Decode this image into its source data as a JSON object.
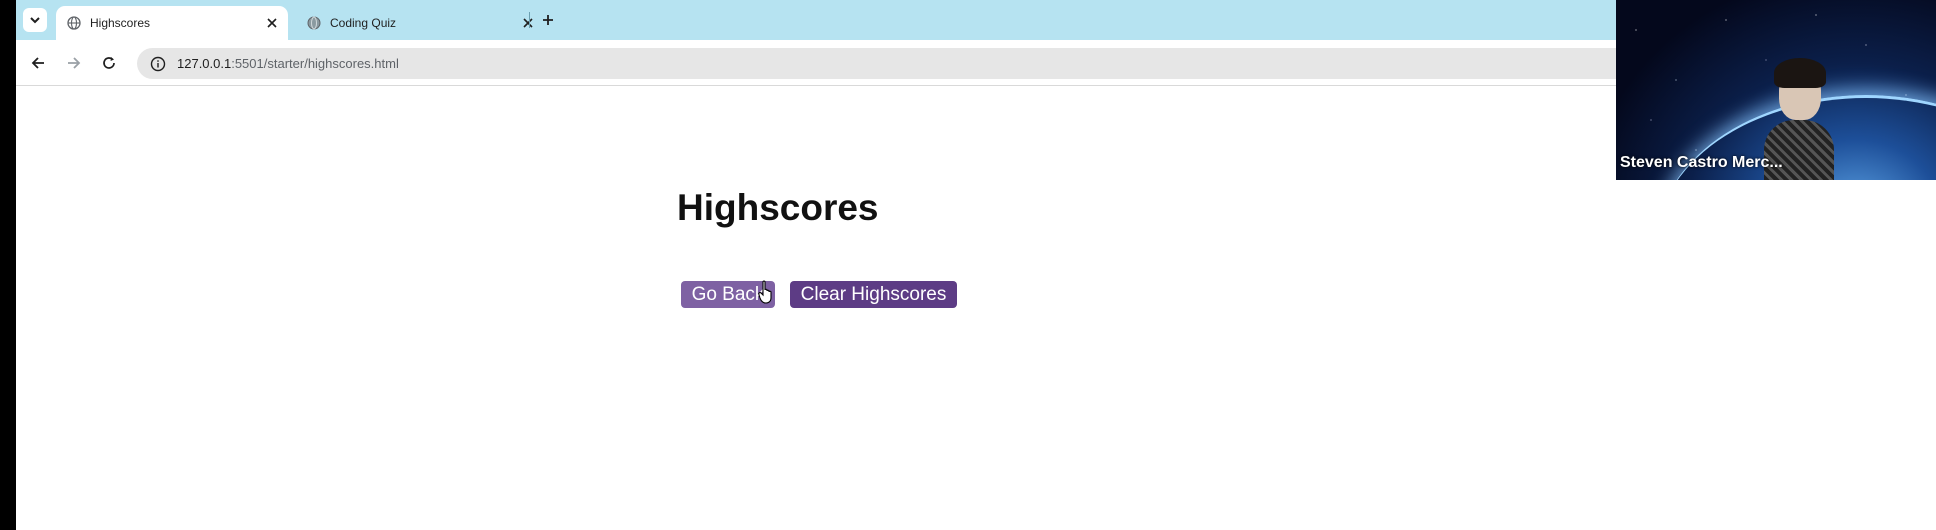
{
  "browser": {
    "tabs": [
      {
        "title": "Highscores",
        "active": true,
        "icon": "globe-icon"
      },
      {
        "title": "Coding Quiz",
        "active": false,
        "icon": "globe-icon"
      }
    ],
    "address_bar": {
      "host": "127.0.0.1",
      "path": ":5501/starter/highscores.html"
    }
  },
  "page": {
    "title": "Highscores",
    "buttons": {
      "go_back": "Go Back",
      "clear": "Clear Highscores"
    },
    "colors": {
      "go_back_bg": "#7e61a3",
      "clear_bg": "#5d3c85"
    }
  },
  "webcam": {
    "name": "Steven Castro Merc..."
  },
  "theme": {
    "tabstrip": "#b6e3f1"
  }
}
